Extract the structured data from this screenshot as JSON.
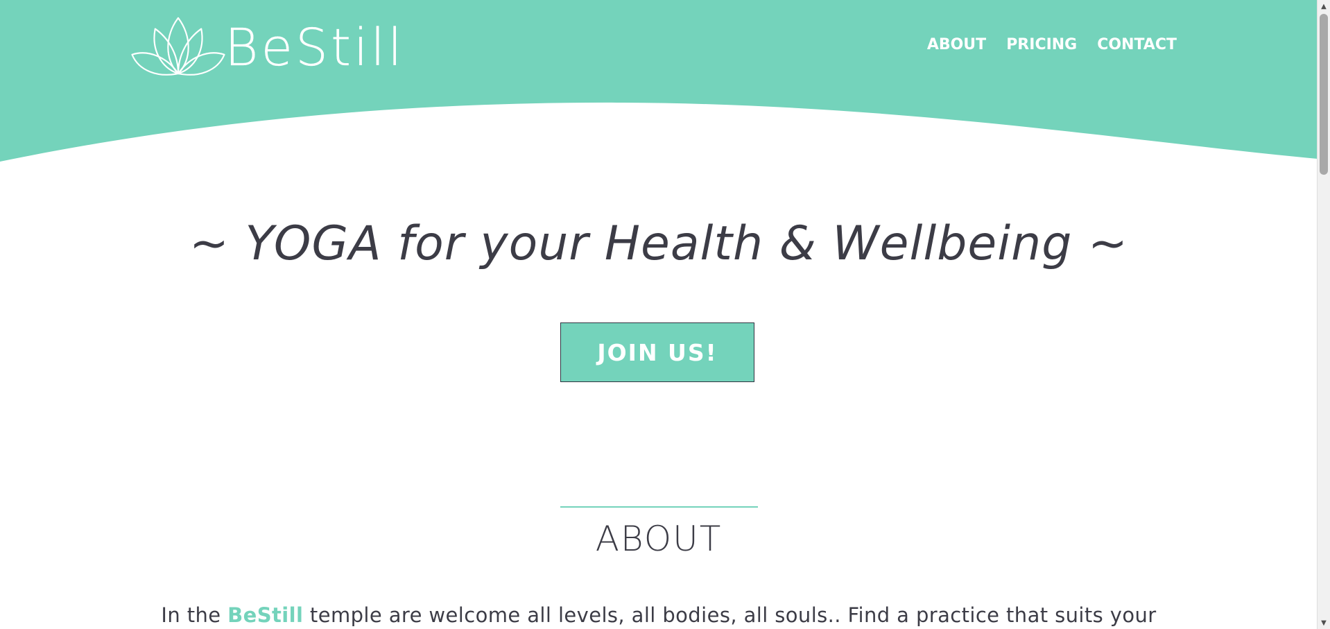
{
  "header": {
    "logo_text": "BeStill",
    "logo_icon": "lotus-icon",
    "nav": [
      {
        "label": "ABOUT"
      },
      {
        "label": "PRICING"
      },
      {
        "label": "CONTACT"
      }
    ]
  },
  "hero": {
    "title": "~ YOGA for your Health & Wellbeing ~",
    "cta_label": "JOIN US!"
  },
  "about": {
    "heading": "ABOUT",
    "text_prefix": "In the ",
    "text_brand": "BeStill",
    "text_suffix": " temple are welcome all levels, all bodies, all souls.. Find a practice that suits your"
  },
  "colors": {
    "accent": "#74d3bb",
    "text": "#3c3c46",
    "background": "#ffffff"
  },
  "scrollbar": {
    "up_icon": "scroll-up-arrow-icon",
    "down_icon": "scroll-down-arrow-icon"
  }
}
